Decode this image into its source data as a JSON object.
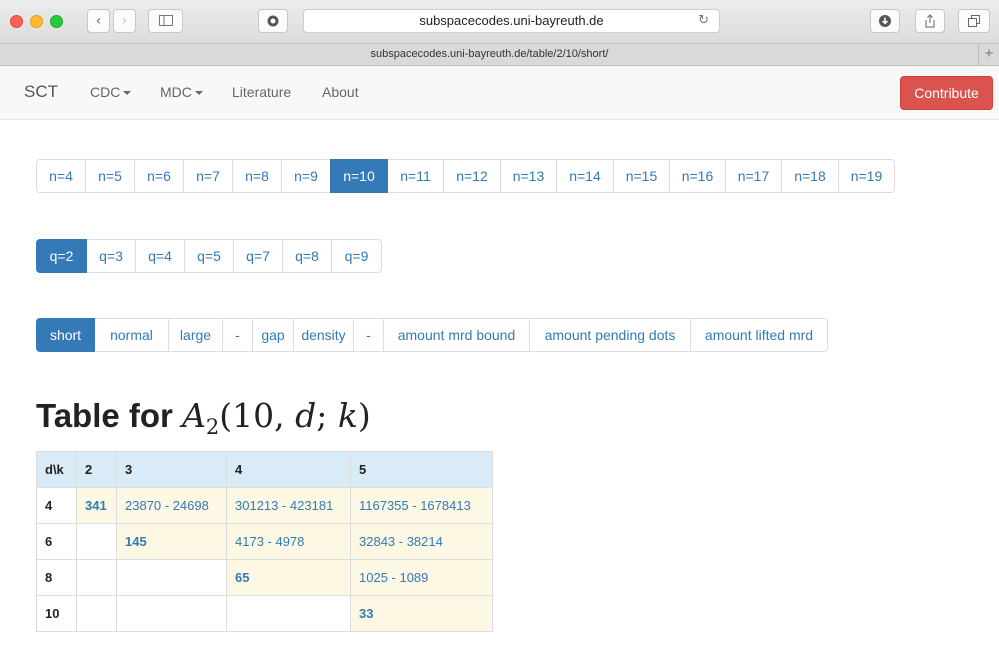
{
  "browser": {
    "address": "subspacecodes.uni-bayreuth.de",
    "tab_title": "subspacecodes.uni-bayreuth.de/table/2/10/short/",
    "icons": [
      "back-icon",
      "forward-icon",
      "sidebar-icon",
      "privacy-icon",
      "reload-icon",
      "download-icon",
      "share-icon",
      "tabs-icon",
      "new-tab-icon"
    ]
  },
  "navbar": {
    "brand": "SCT",
    "items": [
      "CDC",
      "MDC",
      "Literature",
      "About"
    ],
    "contribute": "Contribute"
  },
  "n_pager": {
    "items": [
      "n=4",
      "n=5",
      "n=6",
      "n=7",
      "n=8",
      "n=9",
      "n=10",
      "n=11",
      "n=12",
      "n=13",
      "n=14",
      "n=15",
      "n=16",
      "n=17",
      "n=18",
      "n=19"
    ],
    "active": "n=10"
  },
  "q_pager": {
    "items": [
      "q=2",
      "q=3",
      "q=4",
      "q=5",
      "q=7",
      "q=8",
      "q=9"
    ],
    "active": "q=2"
  },
  "view_pager": {
    "items": [
      "short",
      "normal",
      "large",
      "-",
      "gap",
      "density",
      "-",
      "amount mrd bound",
      "amount pending dots",
      "amount lifted mrd"
    ],
    "active": "short"
  },
  "heading": {
    "prefix": "Table for",
    "math_main": "A",
    "math_sub": "2",
    "math_args": "(10, d; k)"
  },
  "table": {
    "headers": [
      "d\\k",
      "2",
      "3",
      "4",
      "5"
    ],
    "rows": [
      {
        "d": "4",
        "cells": [
          "341",
          "23870 - 24698",
          "301213 - 423181",
          "1167355 - 1678413"
        ]
      },
      {
        "d": "6",
        "cells": [
          "",
          "145",
          "4173 - 4978",
          "32843 - 38214"
        ]
      },
      {
        "d": "8",
        "cells": [
          "",
          "",
          "65",
          "1025 - 1089"
        ]
      },
      {
        "d": "10",
        "cells": [
          "",
          "",
          "",
          "33"
        ]
      }
    ]
  },
  "colors": {
    "accent": "#337ab7",
    "contribute": "#d9534f",
    "header_bg": "#d9ebf6",
    "cell_bg": "#fcf8e3"
  }
}
